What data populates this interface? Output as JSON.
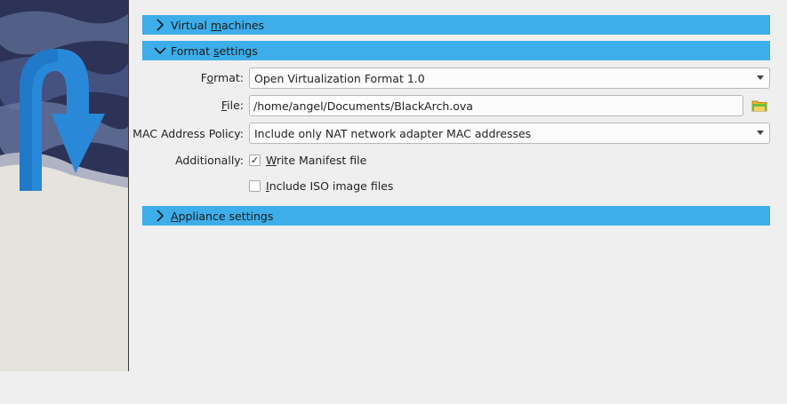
{
  "sections": {
    "virtual_machines": {
      "pre": "Virtual ",
      "key": "m",
      "post": "achines"
    },
    "format_settings": {
      "pre": "Format ",
      "key": "s",
      "post": "ettings"
    },
    "appliance_settings": {
      "pre": "",
      "key": "A",
      "post": "ppliance settings"
    }
  },
  "form": {
    "format": {
      "label_pre": "F",
      "label_key": "o",
      "label_post": "rmat:",
      "value": "Open Virtualization Format 1.0"
    },
    "file": {
      "label_pre": "",
      "label_key": "F",
      "label_post": "ile:",
      "value": "/home/angel/Documents/BlackArch.ova"
    },
    "mac_policy": {
      "label": "MAC Address Policy:",
      "value": "Include only NAT network adapter MAC addresses"
    },
    "additionally": {
      "label": "Additionally:",
      "write_manifest": {
        "pre": "",
        "key": "W",
        "post": "rite Manifest file",
        "checked": true,
        "mark": "✓"
      },
      "include_iso": {
        "pre": "",
        "key": "I",
        "post": "nclude ISO image files",
        "checked": false
      }
    }
  },
  "colors": {
    "section_header_bg": "#3daee9",
    "window_bg": "#efefef"
  },
  "icons": {
    "section_collapsed": "chevron-right-icon",
    "section_expanded": "chevron-down-icon",
    "file_browse": "folder-icon",
    "banner": "export-arrow-icon"
  }
}
